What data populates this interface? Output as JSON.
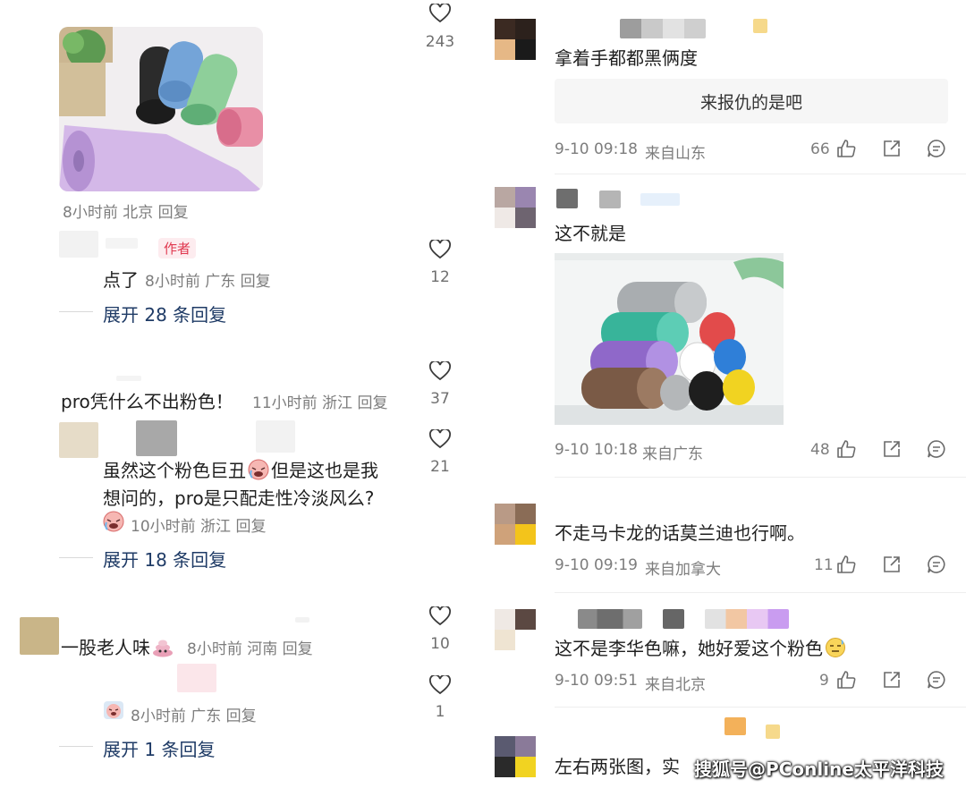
{
  "left": {
    "c1": {
      "meta": "8小时前 北京 回复",
      "likes": "243"
    },
    "c2": {
      "tag": "作者",
      "text": "点了",
      "meta": "8小时前 广东 回复",
      "likes": "12",
      "expand": "展开 28 条回复"
    },
    "c3": {
      "text": "pro凭什么不出粉色！",
      "meta": "11小时前 浙江 回复",
      "likes": "37"
    },
    "c4": {
      "line1": "虽然这个粉色巨丑",
      "line1b": "但是这也是我",
      "line2": "想问的，pro是只配走性冷淡风么?",
      "meta": "10小时前 浙江 回复",
      "likes": "21",
      "expand": "展开 18 条回复"
    },
    "c5": {
      "text": "一股老人味",
      "meta": "8小时前 河南 回复",
      "likes": "10"
    },
    "c6": {
      "meta": "8小时前 广东 回复",
      "likes": "1",
      "expand": "展开 1 条回复"
    }
  },
  "right": {
    "r1": {
      "text": "拿着手都都黑俩度",
      "quote": "来报仇的是吧",
      "time": "9-10 09:18",
      "loc": "来自山东",
      "likes": "66"
    },
    "r2": {
      "text": "这不就是",
      "time": "9-10 10:18",
      "loc": "来自广东",
      "likes": "48"
    },
    "r3": {
      "text": "不走马卡龙的话莫兰迪也行啊。",
      "time": "9-10 09:19",
      "loc": "来自加拿大",
      "likes": "11"
    },
    "r4": {
      "text": "这不是李华色嘛，她好爱这个粉色",
      "time": "9-10 09:51",
      "loc": "来自北京",
      "likes": "9"
    },
    "r5": {
      "text": "左右两张图，实"
    }
  },
  "watermark": "搜狐号@PConline太平洋科技",
  "icons": [
    "heart-icon",
    "thumbs-up-icon",
    "share-icon",
    "comment-icon",
    "crying-emoji-icon",
    "poop-emoji-icon"
  ]
}
